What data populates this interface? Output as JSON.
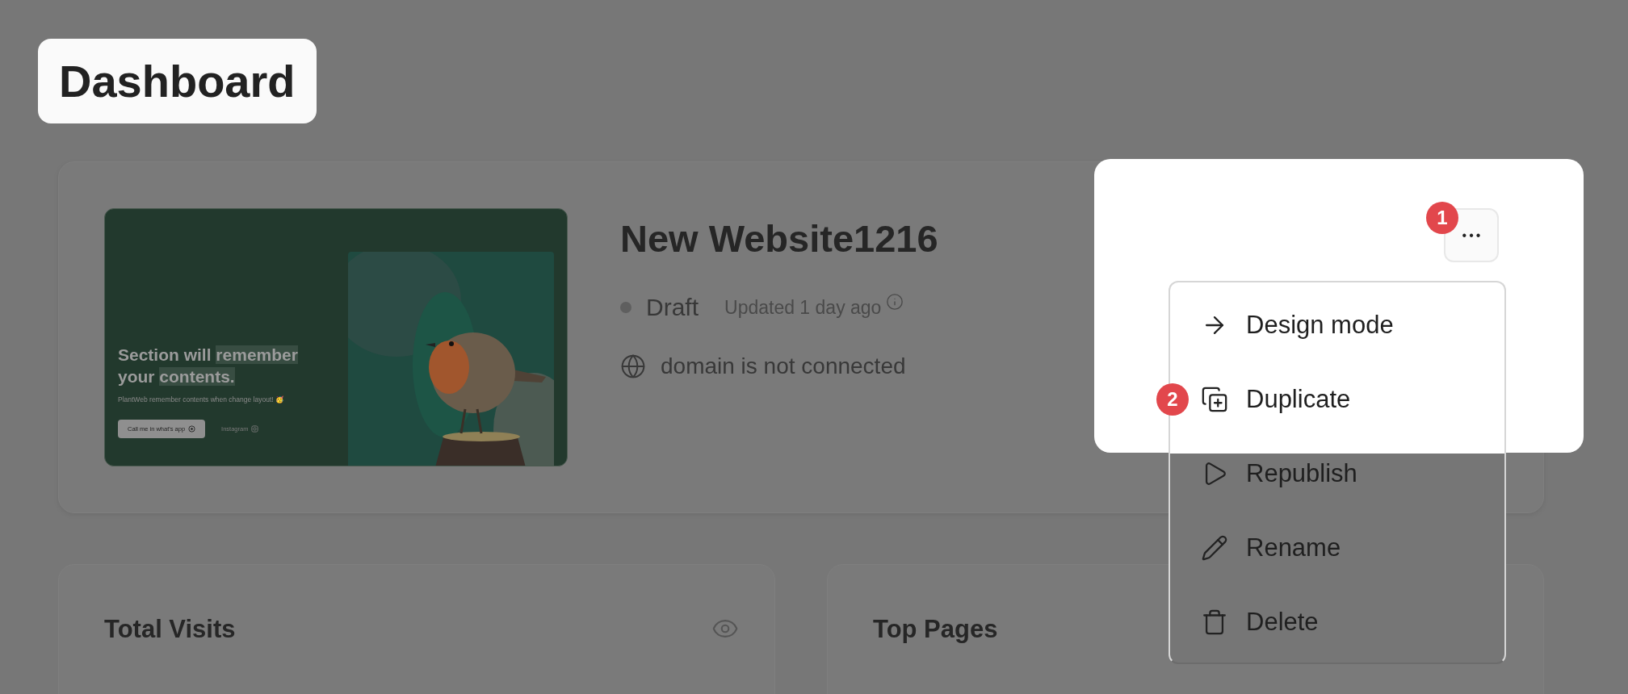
{
  "page_title": {
    "text": "Dashboard",
    "spotlit": true
  },
  "website": {
    "name": "New Website1216",
    "status": "Draft",
    "updated": "Updated 1 day ago",
    "domain": "domain is not connected",
    "preview": {
      "heading": [
        {
          "text": "Section will ",
          "highlighted": false
        },
        {
          "text": "remember",
          "highlighted": true
        },
        {
          "text": " your ",
          "highlighted": false
        },
        {
          "text": "contents.",
          "highlighted": true
        }
      ],
      "subtext": "PlantWeb remember contents when change layout! 🥳",
      "button": "Call me in what's app",
      "link": "Instagram"
    }
  },
  "actions": {
    "spotlit": true,
    "more_button": {
      "label": "•••",
      "step": "1"
    },
    "menu": [
      {
        "kind": "open",
        "label": "Design mode"
      },
      {
        "kind": "duplicate",
        "label": "Duplicate",
        "step": "2"
      },
      {
        "kind": "republish",
        "label": "Republish"
      },
      {
        "kind": "rename",
        "label": "Rename"
      },
      {
        "kind": "delete",
        "label": "Delete"
      }
    ]
  },
  "stats_cards": [
    {
      "kind": "visits",
      "title": "Total Visits"
    },
    {
      "kind": "pages",
      "title": "Top Pages"
    }
  ]
}
